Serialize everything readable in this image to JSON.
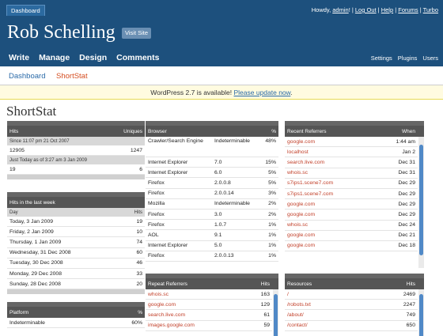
{
  "header": {
    "dashboard_tab": "Dashboard",
    "howdy": "Howdy, ",
    "user": "admin",
    "bang": "! | ",
    "log_out": "Log Out",
    "help": "Help",
    "forums": "Forums",
    "turbo": "Turbo",
    "sep": " | ",
    "site_title": "Rob Schelling",
    "visit_site": "Visit Site",
    "main_nav": [
      "Write",
      "Manage",
      "Design",
      "Comments"
    ],
    "side_nav": [
      "Settings",
      "Plugins",
      "Users"
    ]
  },
  "subnav": {
    "dashboard": "Dashboard",
    "current": "ShortStat"
  },
  "notice": {
    "prefix": "WordPress 2.7 is available! ",
    "link": "Please update now",
    "suffix": "."
  },
  "page_title": "ShortStat",
  "hits": {
    "title": "Hits",
    "uniques": "Uniques",
    "since_label": "Since 11:07 pm 21 Oct 2007",
    "since_hits": "12905",
    "since_uniques": "1247",
    "today_label": "Just Today as of 3:27 am 3 Jan 2009",
    "today_hits": "19",
    "today_uniques": "6"
  },
  "last_week": {
    "title": "Hits in the last week",
    "col_day": "Day",
    "col_hits": "Hits",
    "rows": [
      {
        "day": "Today, 3 Jan 2009",
        "hits": "19"
      },
      {
        "day": "Friday, 2 Jan 2009",
        "hits": "10"
      },
      {
        "day": "Thursday, 1 Jan 2009",
        "hits": "74"
      },
      {
        "day": "Wednesday, 31 Dec 2008",
        "hits": "60"
      },
      {
        "day": "Tuesday, 30 Dec 2008",
        "hits": "46"
      },
      {
        "day": "Monday, 29 Dec 2008",
        "hits": "33"
      },
      {
        "day": "Sunday, 28 Dec 2008",
        "hits": "20"
      }
    ]
  },
  "platform": {
    "title": "Platform",
    "pct": "%",
    "rows": [
      {
        "name": "Indeterminable",
        "pct": "60%"
      }
    ]
  },
  "browser": {
    "title": "Browser",
    "pct": "%",
    "rows": [
      {
        "name": "Crawler/Search Engine",
        "ver": "Indeterminable",
        "pct": "48%"
      },
      {
        "name": "Internet Explorer",
        "ver": "7.0",
        "pct": "15%"
      },
      {
        "name": "Internet Explorer",
        "ver": "6.0",
        "pct": "5%"
      },
      {
        "name": "Firefox",
        "ver": "2.0.0.8",
        "pct": "5%"
      },
      {
        "name": "Firefox",
        "ver": "2.0.0.14",
        "pct": "3%"
      },
      {
        "name": "Mozilla",
        "ver": "Indeterminable",
        "pct": "2%"
      },
      {
        "name": "Firefox",
        "ver": "3.0",
        "pct": "2%"
      },
      {
        "name": "Firefox",
        "ver": "1.0.7",
        "pct": "1%"
      },
      {
        "name": "AOL",
        "ver": "9.1",
        "pct": "1%"
      },
      {
        "name": "Internet Explorer",
        "ver": "5.0",
        "pct": "1%"
      },
      {
        "name": "Firefox",
        "ver": "2.0.0.13",
        "pct": "1%"
      }
    ]
  },
  "recent_referrers": {
    "title": "Recent Referrers",
    "when": "When",
    "rows": [
      {
        "site": "google.com",
        "when": "1:44 am"
      },
      {
        "site": "localhost",
        "when": "Jan 2"
      },
      {
        "site": "search.live.com",
        "when": "Dec 31"
      },
      {
        "site": "whois.sc",
        "when": "Dec 31"
      },
      {
        "site": "s7ips1.scene7.com",
        "when": "Dec 29"
      },
      {
        "site": "s7ips1.scene7.com",
        "when": "Dec 29"
      },
      {
        "site": "google.com",
        "when": "Dec 29"
      },
      {
        "site": "google.com",
        "when": "Dec 29"
      },
      {
        "site": "whois.sc",
        "when": "Dec 24"
      },
      {
        "site": "google.com",
        "when": "Dec 21"
      },
      {
        "site": "google.com",
        "when": "Dec 18"
      }
    ]
  },
  "repeat_referrers": {
    "title": "Repeat Referrers",
    "hits": "Hits",
    "rows": [
      {
        "site": "whois.sc",
        "hits": "163"
      },
      {
        "site": "google.com",
        "hits": "129"
      },
      {
        "site": "search.live.com",
        "hits": "61"
      },
      {
        "site": "images.google.com",
        "hits": "59"
      }
    ]
  },
  "resources": {
    "title": "Resources",
    "hits": "Hits",
    "rows": [
      {
        "path": "/",
        "hits": "2469"
      },
      {
        "path": "/robots.txt",
        "hits": "2247"
      },
      {
        "path": "/about/",
        "hits": "749"
      },
      {
        "path": "/contact/",
        "hits": "650"
      }
    ]
  },
  "colors": {
    "header_bg": "#1d507d",
    "link": "#2a6aa8",
    "accent": "#d54e21",
    "panel_head": "#555555",
    "scroll_thumb": "#5089c7"
  }
}
